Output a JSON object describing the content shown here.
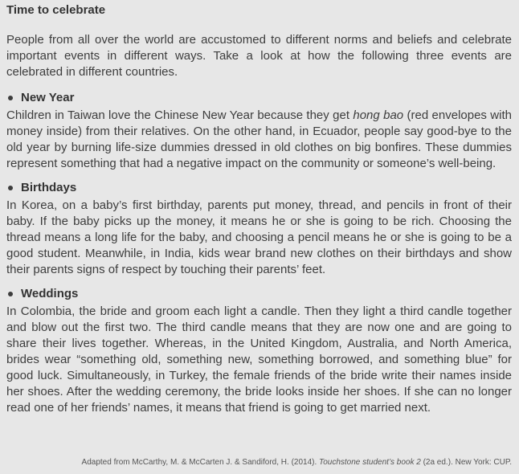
{
  "title": "Time to celebrate",
  "intro": "People from all over the world are accustomed to different norms and beliefs and celebrate important events in different ways. Take a look at how the following three events are celebrated in different countries.",
  "sections": [
    {
      "heading": "New Year",
      "text_before_italic": "Children in Taiwan love the Chinese New Year because they get ",
      "italic": "hong bao",
      "text_after_italic": " (red envelopes with money inside) from their relatives. On the other hand, in Ecuador, people say good-bye to the old year by burning life-size dummies dressed in old clothes on big bonfires. These dummies represent something that had a negative impact on the community or someone’s well-being."
    },
    {
      "heading": "Birthdays",
      "text": "In Korea, on a baby’s first birthday, parents put money, thread, and pencils in front of their baby. If the baby picks up the money, it means he or she is going to be rich. Choosing the thread means a long life for the baby, and choosing a pencil means he or she is going to be a good student. Meanwhile, in India, kids wear brand new clothes on their birthdays and show their parents signs of respect by touching their parents’ feet."
    },
    {
      "heading": "Weddings",
      "text": "In Colombia, the bride and groom each light a candle. Then they light a third candle together and blow out the first two. The third candle means that they are now one and are going to share their lives together. Whereas, in the United Kingdom, Australia, and North America, brides wear “something old, something new, something borrowed, and something blue” for good luck. Simultaneously, in Turkey, the female friends of the bride write their names inside her shoes. After the wedding ceremony, the bride looks inside her shoes. If she can no longer read one of her friends’ names, it means that friend is going to get married next."
    }
  ],
  "source": {
    "prefix": "Adapted from McCarthy, M. & McCarten J. & Sandiford, H. (2014). ",
    "book": "Touchstone student’s book 2",
    "suffix": " (2a ed.). New York: CUP."
  }
}
